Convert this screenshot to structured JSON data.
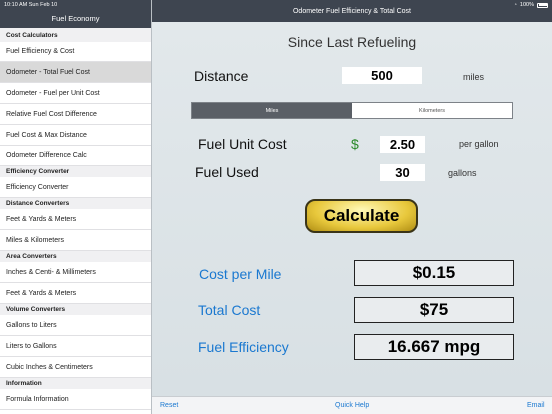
{
  "status": {
    "time": "10:10 AM  Sun Feb 10",
    "battery": "100%"
  },
  "sidebar": {
    "title": "Fuel Economy",
    "rows": [
      {
        "type": "section",
        "label": "Cost Calculators",
        "h": 14
      },
      {
        "type": "item",
        "label": "Fuel Efficiency & Cost",
        "h": 20
      },
      {
        "type": "item",
        "label": "Odometer - Total Fuel Cost",
        "h": 21,
        "selected": true
      },
      {
        "type": "item",
        "label": "Odometer - Fuel per Unit Cost",
        "h": 21
      },
      {
        "type": "item",
        "label": "Relative Fuel Cost Difference",
        "h": 21
      },
      {
        "type": "item",
        "label": "Fuel Cost & Max Distance",
        "h": 21
      },
      {
        "type": "item",
        "label": "Odometer Difference Calc",
        "h": 20
      },
      {
        "type": "section",
        "label": "Efficiency Converter",
        "h": 11
      },
      {
        "type": "item",
        "label": "Efficiency Converter",
        "h": 21
      },
      {
        "type": "section",
        "label": "Distance Converters",
        "h": 11
      },
      {
        "type": "item",
        "label": "Feet & Yards & Meters",
        "h": 21
      },
      {
        "type": "item",
        "label": "Miles & Kilometers",
        "h": 21
      },
      {
        "type": "section",
        "label": "Area Converters",
        "h": 11
      },
      {
        "type": "item",
        "label": "Inches & Centi- & Millimeters",
        "h": 21
      },
      {
        "type": "item",
        "label": "Feet & Yards & Meters",
        "h": 21
      },
      {
        "type": "section",
        "label": "Volume Converters",
        "h": 11
      },
      {
        "type": "item",
        "label": "Gallons to Liters",
        "h": 21
      },
      {
        "type": "item",
        "label": "Liters to Gallons",
        "h": 21
      },
      {
        "type": "item",
        "label": "Cubic Inches & Centimeters",
        "h": 21
      },
      {
        "type": "section",
        "label": "Information",
        "h": 11
      },
      {
        "type": "item",
        "label": "Formula Information",
        "h": 21
      }
    ]
  },
  "header": {
    "title": "Odometer Fuel Efficiency & Total Cost"
  },
  "main": {
    "heading": "Since Last Refueling",
    "distance": {
      "label": "Distance",
      "value": "500",
      "unit": "miles"
    },
    "unit_toggle": {
      "miles": "Miles",
      "kilometers": "Kilometers",
      "selected": "Miles"
    },
    "fuel_unit_cost": {
      "label": "Fuel Unit Cost",
      "currency": "$",
      "value": "2.50",
      "unit": "per gallon"
    },
    "fuel_used": {
      "label": "Fuel Used",
      "value": "30",
      "unit": "gallons"
    },
    "calculate_label": "Calculate",
    "results": {
      "cost_per_mile": {
        "label": "Cost per Mile",
        "value": "$0.15"
      },
      "total_cost": {
        "label": "Total Cost",
        "value": "$75"
      },
      "fuel_efficiency": {
        "label": "Fuel Efficiency",
        "value": "16.667 mpg"
      }
    }
  },
  "footer": {
    "reset": "Reset",
    "quick_help": "Quick Help",
    "email": "Email"
  },
  "colors": {
    "header_bg": "#3e4550",
    "accent_blue": "#1a78d0",
    "gold": "#e8c83c",
    "green": "#2a8a2a"
  },
  "icons": [
    "wifi-icon",
    "battery-icon"
  ]
}
